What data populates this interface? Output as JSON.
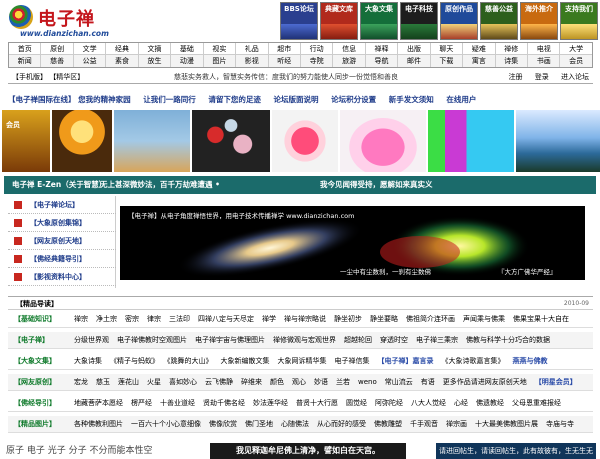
{
  "header": {
    "logo_text": "电子禅",
    "logo_url": "www.dianzichan.com",
    "banners": [
      {
        "label": "BBS论坛",
        "color": "#2a3f8f"
      },
      {
        "label": "典藏文库",
        "color": "#b12a1c"
      },
      {
        "label": "大象文集",
        "color": "#146e3a"
      },
      {
        "label": "电子科技",
        "color": "#1d1d1d"
      },
      {
        "label": "原创作品",
        "color": "#1f4a9a"
      },
      {
        "label": "慈善公益",
        "color": "#2d5f1c"
      },
      {
        "label": "海外推介",
        "color": "#c86a10"
      },
      {
        "label": "支持我们",
        "color": "#3b7a1f"
      }
    ]
  },
  "nav": {
    "row1": [
      "首页",
      "原创",
      "文学",
      "经典",
      "文摘",
      "基础",
      "视实",
      "礼品",
      "超市",
      "行动",
      "信息",
      "禅释",
      "出版",
      "聊天",
      "疑难",
      "禅修",
      "电视",
      "大学"
    ],
    "row2": [
      "新闻",
      "慈善",
      "公益",
      "素食",
      "放生",
      "动漫",
      "图片",
      "影视",
      "听经",
      "寺院",
      "旅游",
      "导航",
      "邮件",
      "下载",
      "寓言",
      "诗集",
      "书画",
      "会员"
    ]
  },
  "announcement": {
    "left": "【手机版】 【精华区】",
    "middle": "慈悲实务救人，智慧实务传信：度我们的努力能使人同步一份觉悟和善良",
    "right": [
      "注册",
      "登录",
      "进入论坛"
    ]
  },
  "linkbar": [
    "【电子禅国际在线】 您我的精神家园",
    "让我们一路同行",
    "请留下您的足迹",
    "论坛版面说明",
    "论坛积分设置",
    "新手发文须知",
    "在线用户"
  ],
  "green_band": {
    "t1": "电子禅 E-Zen（关于智慧）",
    "t2": "无上甚深微妙法，百千万劫难遭遇 •",
    "t3": "我今见闻得受持，愿解如来真实义"
  },
  "left_menu": [
    "【电子禅论坛】",
    "【大象原创集锦】",
    "【网友原创天地】",
    "【佛经典籍导引】",
    "【影视资料中心】"
  ],
  "feature": {
    "caption": "【电子禅】从电子角度禅悟世界，用电子技术传播禅学 www.dianzichan.com",
    "sub1": "一尘中有尘数刹，一刹有尘数佛",
    "sub2": "『大方广佛华严经』"
  },
  "guide": {
    "title": "【精品导读】",
    "date": "2010-09",
    "rows": [
      {
        "label": "【基础知识】",
        "items": [
          "禅宗",
          "净土宗",
          "密宗",
          "律宗",
          "三法印",
          "四禅八定与天尽定",
          "禅学",
          "禅与禅宗略说",
          "静坐初步",
          "静坐要略",
          "佛祖简介连环画",
          "声闻乘与佛乘",
          "佛果宝果十大自在"
        ]
      },
      {
        "label": "【电子禅】",
        "items": [
          "分级世界观",
          "电子禅佛教时空观图片",
          "电子禅宇宙与佛理图片",
          "禅修微观与宏观世界",
          "超越轮回",
          "穿透时空",
          "电子禅三乘宗",
          "佛教与科学十分巧合的数据"
        ]
      },
      {
        "label": "【大象文集】",
        "items": [
          "大象诗集",
          "《精子与蚂蚁》",
          "《跳舞的大山》",
          "大象新编散文集",
          "大象网诉精华集",
          "电子禅信集",
          "【电子禅】嘉言录",
          "《大象诗歌嘉言集》",
          "燕燕与佛教"
        ]
      },
      {
        "label": "【网友原创】",
        "items": [
          "宏龙",
          "慈玉",
          "莲花山",
          "火星",
          "喜如妙心",
          "云飞佛静",
          "碎维来",
          "颜色",
          "观心",
          "妙语",
          "兰若",
          "weno",
          "常山流云",
          "有语",
          "更多作品请进网友原创天地",
          "【明星会员】"
        ]
      },
      {
        "label": "【佛经导引】",
        "items": [
          "地藏菩萨本愿经",
          "楞严经",
          "十善业道经",
          "贤劫千佛名经",
          "妙法莲华经",
          "普贤十大行愿",
          "圆觉经",
          "阿弥陀经",
          "八大人觉经",
          "心经",
          "佛遗教经",
          "父母恩重难报经"
        ]
      },
      {
        "label": "【精品图片】",
        "items": [
          "各种佛教利图片",
          "一百六十个小心意细像",
          "佛像欣赏",
          "佛门圣地",
          "心随佛法",
          "从心而好的感受",
          "佛教雕塑",
          "千手观音",
          "禅宗画",
          "十大最美佛教图片展",
          "寺庙与寺"
        ]
      }
    ]
  },
  "bottom": {
    "b1": "原子 电子 光子 分子 不分而能本性空",
    "b2": "我见释迦牟尼佛上清净，譬如白在天宫。",
    "b3": "请进回帖生，请读回帖生，此有故彼有，生无生无"
  }
}
